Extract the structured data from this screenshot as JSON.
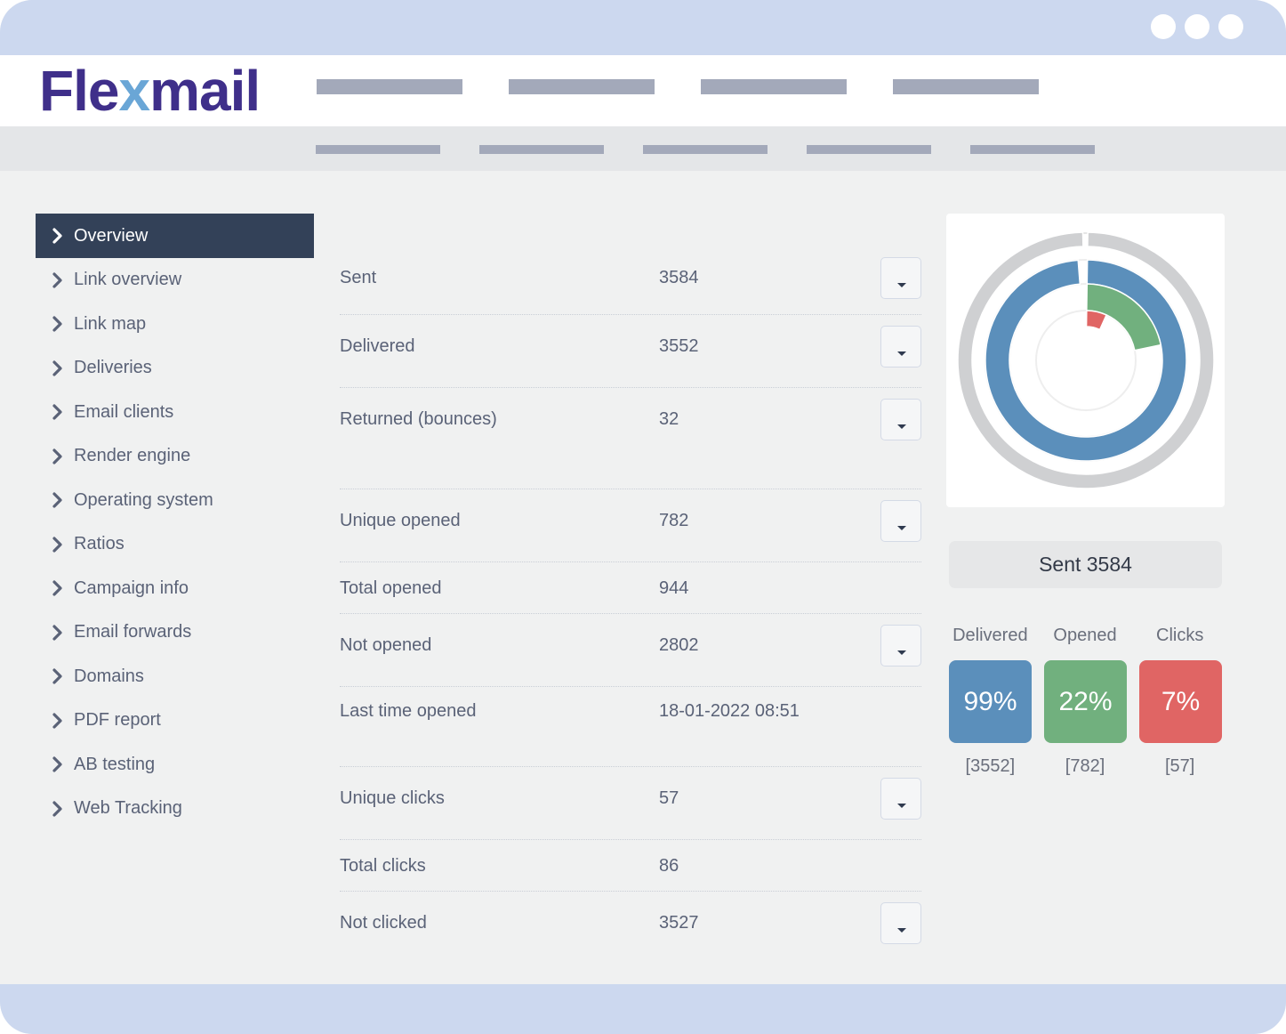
{
  "app": {
    "brand": {
      "prefix": "Fle",
      "x": "x",
      "suffix": "mail"
    }
  },
  "colors": {
    "delivered": "#5b8fbb",
    "opened": "#71b07e",
    "clicks": "#e06564",
    "outer_ring": "#cfd0d2",
    "sidebar_active": "#334158",
    "window_chrome": "#ccd8ef"
  },
  "sidebar": {
    "items": [
      {
        "label": "Overview",
        "active": true
      },
      {
        "label": "Link overview"
      },
      {
        "label": "Link map"
      },
      {
        "label": "Deliveries"
      },
      {
        "label": "Email clients"
      },
      {
        "label": "Render engine"
      },
      {
        "label": "Operating system"
      },
      {
        "label": "Ratios"
      },
      {
        "label": "Campaign info"
      },
      {
        "label": "Email forwards"
      },
      {
        "label": "Domains"
      },
      {
        "label": "PDF report"
      },
      {
        "label": "AB testing"
      },
      {
        "label": "Web Tracking"
      }
    ]
  },
  "stats": {
    "rows": [
      {
        "label": "Sent",
        "value": "3584",
        "dropdown": true
      },
      {
        "label": "Delivered",
        "value": "3552",
        "dropdown": true
      },
      {
        "label": "Returned (bounces)",
        "value": "32",
        "dropdown": true
      },
      {
        "label": "Unique opened",
        "value": "782",
        "dropdown": true
      },
      {
        "label": "Total opened",
        "value": "944",
        "dropdown": false
      },
      {
        "label": "Not opened",
        "value": "2802",
        "dropdown": true
      },
      {
        "label": "Last time opened",
        "value": "18-01-2022 08:51",
        "dropdown": false
      },
      {
        "label": "Unique clicks",
        "value": "57",
        "dropdown": true
      },
      {
        "label": "Total clicks",
        "value": "86",
        "dropdown": false
      },
      {
        "label": "Not clicked",
        "value": "3527",
        "dropdown": true
      }
    ]
  },
  "summary": {
    "sent_label": "Sent 3584",
    "kpis": [
      {
        "label": "Delivered",
        "percent": "99%",
        "count": "[3552]"
      },
      {
        "label": "Opened",
        "percent": "22%",
        "count": "[782]"
      },
      {
        "label": "Clicks",
        "percent": "7%",
        "count": "[57]"
      }
    ]
  },
  "chart_data": {
    "type": "pie",
    "title": "",
    "series": [
      {
        "name": "Sent",
        "value": 3584,
        "fraction": 1.0
      },
      {
        "name": "Delivered",
        "value": 3552,
        "fraction": 0.99
      },
      {
        "name": "Opened",
        "value": 782,
        "fraction": 0.22
      },
      {
        "name": "Clicks",
        "value": 57,
        "fraction": 0.07
      }
    ]
  }
}
